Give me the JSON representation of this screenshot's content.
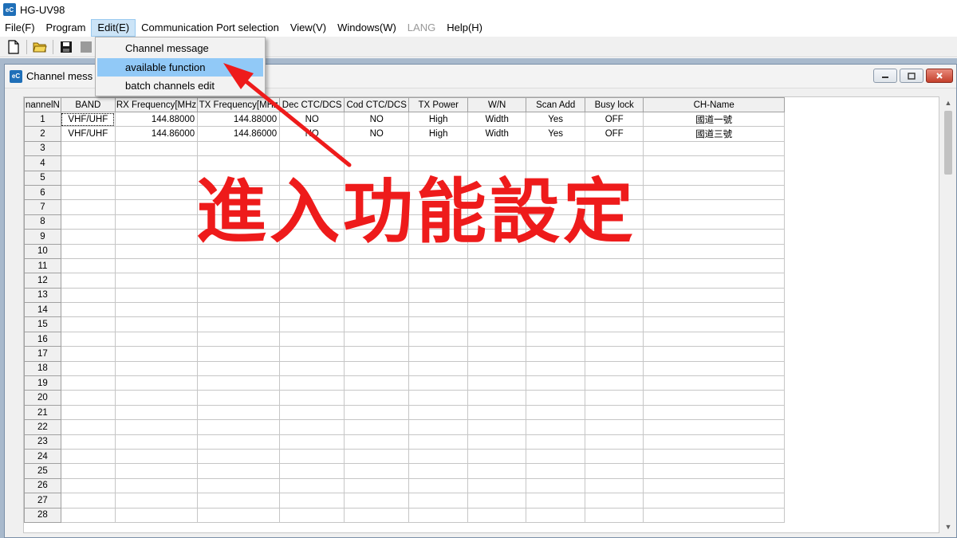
{
  "app": {
    "title": "HG-UV98",
    "icon_label": "eC"
  },
  "menu": [
    {
      "label": "File(F)"
    },
    {
      "label": "Program"
    },
    {
      "label": "Edit(E)",
      "state": "open"
    },
    {
      "label": "Communication Port selection"
    },
    {
      "label": "View(V)"
    },
    {
      "label": "Windows(W)"
    },
    {
      "label": "LANG",
      "state": "disabled"
    },
    {
      "label": "Help(H)"
    }
  ],
  "toolbar": {
    "icons": [
      "new-file-icon",
      "open-folder-icon",
      "save-disk-icon",
      "disabled-tool-icon"
    ]
  },
  "edit_menu": {
    "items": [
      {
        "label": "Channel message"
      },
      {
        "label": "available function",
        "highlighted": true
      },
      {
        "label": "batch channels edit"
      }
    ]
  },
  "child_window": {
    "title": "Channel mess",
    "icon_label": "eC",
    "controls": [
      "minimize-icon",
      "restore-icon",
      "close-icon"
    ]
  },
  "grid": {
    "columns": [
      "nannelN",
      "BAND",
      "RX Frequency[MHz",
      "TX Frequency[MHz",
      "Dec CTC/DCS",
      "Cod CTC/DCS",
      "TX Power",
      "W/N",
      "Scan Add",
      "Busy lock",
      "CH-Name"
    ],
    "rows": [
      {
        "cells": [
          "1",
          "VHF/UHF",
          "144.88000",
          "144.88000",
          "NO",
          "NO",
          "High",
          "Width",
          "Yes",
          "OFF",
          "國道一號"
        ]
      },
      {
        "cells": [
          "2",
          "VHF/UHF",
          "144.86000",
          "144.86000",
          "NO",
          "NO",
          "High",
          "Width",
          "Yes",
          "OFF",
          "國道三號"
        ]
      },
      {
        "cells": [
          "3"
        ]
      },
      {
        "cells": [
          "4"
        ]
      },
      {
        "cells": [
          "5"
        ]
      },
      {
        "cells": [
          "6"
        ]
      },
      {
        "cells": [
          "7"
        ]
      },
      {
        "cells": [
          "8"
        ]
      },
      {
        "cells": [
          "9"
        ]
      },
      {
        "cells": [
          "10"
        ]
      },
      {
        "cells": [
          "11"
        ]
      },
      {
        "cells": [
          "12"
        ]
      },
      {
        "cells": [
          "13"
        ]
      },
      {
        "cells": [
          "14"
        ]
      },
      {
        "cells": [
          "15"
        ]
      },
      {
        "cells": [
          "16"
        ]
      },
      {
        "cells": [
          "17"
        ]
      },
      {
        "cells": [
          "18"
        ]
      },
      {
        "cells": [
          "19"
        ]
      },
      {
        "cells": [
          "20"
        ]
      },
      {
        "cells": [
          "21"
        ]
      },
      {
        "cells": [
          "22"
        ]
      },
      {
        "cells": [
          "23"
        ]
      },
      {
        "cells": [
          "24"
        ]
      },
      {
        "cells": [
          "25"
        ]
      },
      {
        "cells": [
          "26"
        ]
      },
      {
        "cells": [
          "27"
        ]
      },
      {
        "cells": [
          "28"
        ]
      }
    ]
  },
  "annotation": {
    "text": "進入功能設定",
    "color": "#ee1b1b"
  }
}
